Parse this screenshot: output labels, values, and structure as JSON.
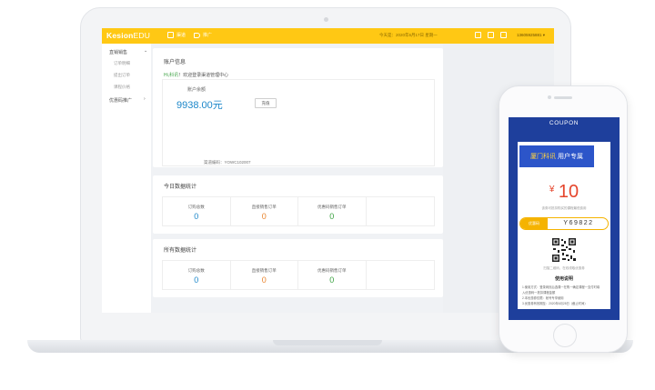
{
  "header": {
    "brand_main": "Kesion",
    "brand_suffix": "EDU",
    "nav": [
      {
        "label": "渠道",
        "active": true
      },
      {
        "label": "推广",
        "active": false
      }
    ],
    "notice": "今天是：2020年6月17日 星期一",
    "username": "13605925881"
  },
  "sidebar": {
    "group1": "直销销售",
    "items": [
      "订单明细",
      "提出订单",
      "课程价格"
    ],
    "group2": "优惠码推广"
  },
  "account": {
    "title": "账户信息",
    "hint_prefix": "Hi,",
    "hint_name": "科讯",
    "hint_suffix": "！欢迎登录渠道管理中心",
    "balance_label": "账户余额",
    "balance_value": "9938.00元",
    "recharge_label": "充值",
    "channel_code": "渠道编码：YOWC102007"
  },
  "today": {
    "title": "今日数据统计",
    "stats": [
      {
        "label": "订购总数",
        "value": "0"
      },
      {
        "label": "直接销售订单",
        "value": "0"
      },
      {
        "label": "优惠码销售订单",
        "value": "0"
      }
    ]
  },
  "all": {
    "title": "所有数据统计",
    "stats": [
      {
        "label": "订购总数",
        "value": "0"
      },
      {
        "label": "直接销售订单",
        "value": "0"
      },
      {
        "label": "优惠码销售订单",
        "value": "0"
      }
    ]
  },
  "coupon": {
    "header": "COUPON",
    "banner_highlight": "厦门科讯",
    "banner_rest": "用户专属",
    "currency": "¥",
    "amount": "10",
    "usage": "该券可抵扣购买的课程最低费用",
    "code_label": "优惠码",
    "code_value": "Y69822",
    "qr_tip": "扫描二维码，在线领取优惠券",
    "rules_title": "使用说明",
    "rules": [
      "1.使用方式：登录网页后选课一在购一确定课程一支付时填",
      "入优惠码一抵扣课程金额",
      "2.本优惠券仅限：帐号专享使用",
      "3.优惠券有效期至：2020年6月28日（截止时间）"
    ]
  },
  "colors": {
    "accent": "#ffc814",
    "balance": "#1c87c9",
    "stat_blue": "#1c87c9",
    "stat_orange": "#e8832c",
    "stat_green": "#3aa140",
    "coupon_bg": "#1e3f9c",
    "coupon_red": "#e5452c"
  }
}
